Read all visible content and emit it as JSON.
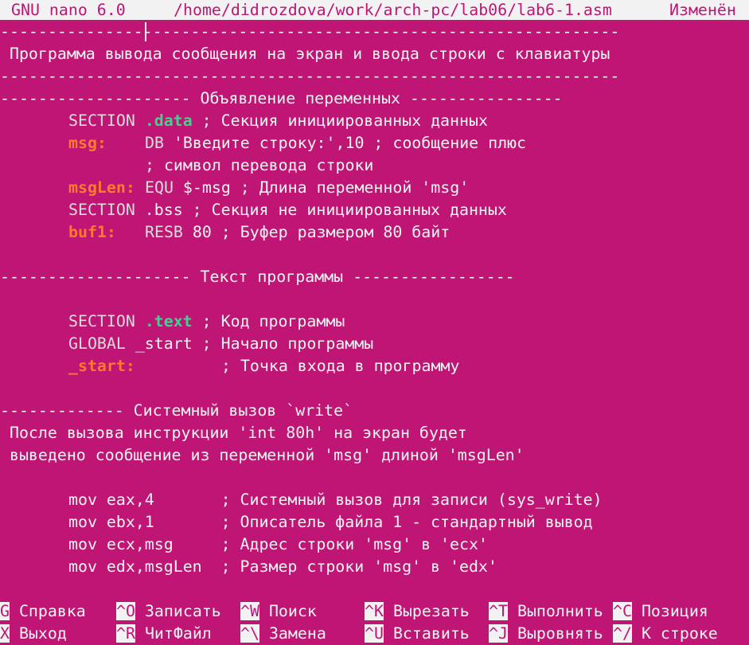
{
  "titlebar": {
    "app": "GNU nano 6.0",
    "path": "/home/didrozdova/work/arch-pc/lab06/lab6-1.asm",
    "status": "Изменён"
  },
  "lines": {
    "l1": "-----------------------------------------------------------------",
    "l2": " Программа вывода сообщения на экран и ввода строки с клавиатуры",
    "l3": "-----------------------------------------------------------------",
    "l4": "-------------------- Объявление переменных ----------------",
    "l5_kw": "SECTION",
    "l5_dir": ".data",
    "l5_rest": " ; Секция инициированных данных",
    "l6_label": "msg:",
    "l6_kw": "DB",
    "l6_rest": " 'Введите строку:',10 ; сообщение плюс",
    "l7": "; символ перевода строки",
    "l8_label": "msgLen:",
    "l8_kw": "EQU",
    "l8_rest": " $-msg ; Длина переменной 'msg'",
    "l9_kw": "SECTION",
    "l9_rest": " .bss ; Секция не инициированных данных",
    "l10_label": "buf1:",
    "l10_kw": "RESB",
    "l10_rest": " 80 ; Буфер размером 80 байт",
    "l12": "-------------------- Текст программы -----------------",
    "l14_kw": "SECTION",
    "l14_dir": ".text",
    "l14_rest": " ; Код программы",
    "l15_kw": "GLOBAL",
    "l15_rest": " _start ; Начало программы",
    "l16_label": "_start:",
    "l16_rest": "; Точка входа в программу",
    "l18": "------------- Системный вызов `write`",
    "l19": " После вызова инструкции 'int 80h' на экран будет",
    "l20": " выведено сообщение из переменной 'msg' длиной 'msgLen'",
    "l22": "mov eax,4       ; Системный вызов для записи (sys_write)",
    "l23": "mov ebx,1       ; Описатель файла 1 - стандартный вывод",
    "l24": "mov ecx,msg     ; Адрес строки 'msg' в 'ecx'",
    "l25": "mov edx,msgLen  ; Размер строки 'msg' в 'edx'"
  },
  "shortcuts": [
    {
      "key": "^G",
      "label": "Справка"
    },
    {
      "key": "^O",
      "label": "Записать"
    },
    {
      "key": "^W",
      "label": "Поиск"
    },
    {
      "key": "^K",
      "label": "Вырезать"
    },
    {
      "key": "^T",
      "label": "Выполнить"
    },
    {
      "key": "^C",
      "label": "Позиция"
    },
    {
      "key": "^X",
      "label": "Выход"
    },
    {
      "key": "^R",
      "label": "ЧитФайл"
    },
    {
      "key": "^\\",
      "label": "Замена"
    },
    {
      "key": "^U",
      "label": "Вставить"
    },
    {
      "key": "^J",
      "label": "Выровнять"
    },
    {
      "key": "^/",
      "label": "К строке"
    }
  ],
  "colors": {
    "background": "#bf1575",
    "foreground": "#f2f2f2",
    "directive": "#3fd38e",
    "label": "#ff7a2a"
  }
}
